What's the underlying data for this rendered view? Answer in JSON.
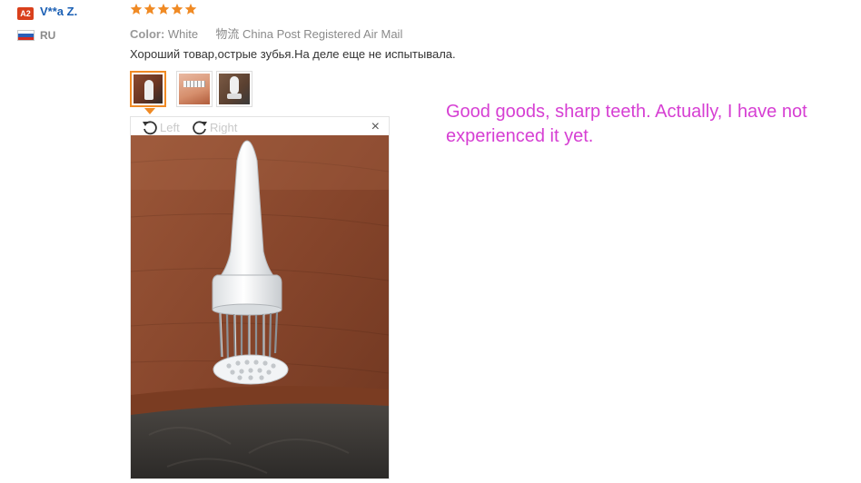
{
  "reviewer": {
    "level_badge": "A2",
    "name": "V**a Z.",
    "country_code": "RU"
  },
  "review": {
    "rating": 5,
    "star_color": "#f08a24",
    "color_label": "Color:",
    "color_value": "White",
    "logistics_label": "物流",
    "logistics_value": "China Post Registered Air Mail",
    "text": "Хороший товар,острые зубья.На деле еще не испытывала."
  },
  "thumbnails": [
    {
      "name": "photo-1",
      "active": true
    },
    {
      "name": "photo-2",
      "active": false
    },
    {
      "name": "photo-3",
      "active": false
    }
  ],
  "viewer": {
    "rotate_left_label": "Left",
    "rotate_right_label": "Right",
    "close_glyph": "×"
  },
  "translation": "Good goods, sharp teeth. Actually, I have not experienced it yet.",
  "colors": {
    "accent": "#f08a24",
    "translation": "#d63fd3",
    "name": "#1a5fb4"
  }
}
